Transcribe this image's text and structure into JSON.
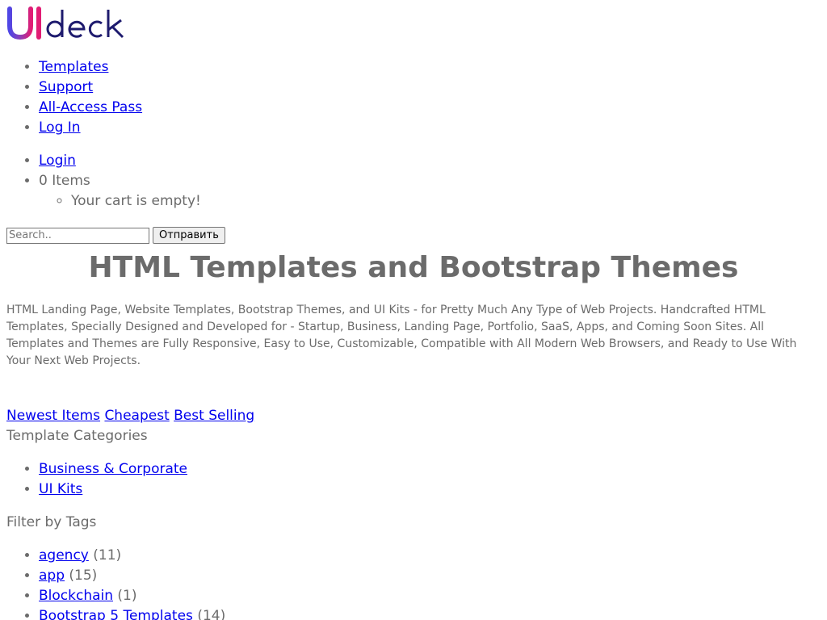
{
  "brand": {
    "logo_text": "UIdeck",
    "colors": {
      "gradient_start": "#4f46e5",
      "gradient_mid": "#8b3fb8",
      "gradient_end": "#e11d74",
      "deck_color": "#1e1b6e"
    }
  },
  "main_nav": [
    {
      "label": "Templates"
    },
    {
      "label": "Support"
    },
    {
      "label": "All-Access Pass"
    },
    {
      "label": "Log In"
    }
  ],
  "user_nav": {
    "login_label": "Login",
    "cart_label": "0 Items",
    "cart_empty": "Your cart is empty!"
  },
  "search": {
    "placeholder": "Search..",
    "button_label": "Отправить"
  },
  "hero": {
    "title": "HTML Templates and Bootstrap Themes",
    "description": "HTML Landing Page, Website Templates, Bootstrap Themes, and UI Kits - for Pretty Much Any Type of Web Projects. Handcrafted HTML Templates, Specially Designed and Developed for - Startup, Business, Landing Page, Portfolio, SaaS, Apps, and Coming Soon Sites. All Templates and Themes are Fully Responsive, Easy to Use, Customizable, Compatible with All Modern Web Browsers, and Ready to Use With Your Next Web Projects."
  },
  "sort": {
    "newest": "Newest Items",
    "cheapest": "Cheapest",
    "best_selling": "Best Selling"
  },
  "categories": {
    "heading": "Template Categories",
    "items": [
      {
        "label": "Business & Corporate"
      },
      {
        "label": "UI Kits"
      }
    ]
  },
  "tags": {
    "heading": "Filter by Tags",
    "items": [
      {
        "label": "agency",
        "count": "(11)"
      },
      {
        "label": "app",
        "count": "(15)"
      },
      {
        "label": "Blockchain",
        "count": "(1)"
      },
      {
        "label": "Bootstrap 5 Templates",
        "count": "(14)"
      }
    ]
  },
  "colors": {
    "link": "#0000ee",
    "text": "#6b6b6b"
  }
}
